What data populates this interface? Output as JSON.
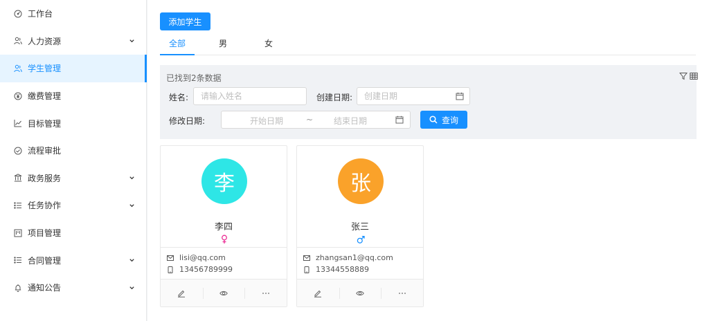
{
  "sidebar": {
    "items": [
      {
        "label": "工作台",
        "icon": "dashboard-icon",
        "has_children": false
      },
      {
        "label": "人力资源",
        "icon": "team-icon",
        "has_children": true
      },
      {
        "label": "学生管理",
        "icon": "team-icon",
        "has_children": false,
        "active": true
      },
      {
        "label": "缴费管理",
        "icon": "yen-icon",
        "has_children": false
      },
      {
        "label": "目标管理",
        "icon": "line-chart-icon",
        "has_children": false
      },
      {
        "label": "流程审批",
        "icon": "check-circle-icon",
        "has_children": false
      },
      {
        "label": "政务服务",
        "icon": "bank-icon",
        "has_children": true
      },
      {
        "label": "任务协作",
        "icon": "list-icon",
        "has_children": true
      },
      {
        "label": "项目管理",
        "icon": "project-icon",
        "has_children": false
      },
      {
        "label": "合同管理",
        "icon": "list-icon",
        "has_children": true
      },
      {
        "label": "通知公告",
        "icon": "bell-icon",
        "has_children": true
      }
    ]
  },
  "toolbar": {
    "add_label": "添加学生"
  },
  "tabs": [
    {
      "label": "全部",
      "active": true
    },
    {
      "label": "男",
      "active": false
    },
    {
      "label": "女",
      "active": false
    }
  ],
  "filter": {
    "found_text": "已找到2条数据",
    "name_label": "姓名:",
    "name_placeholder": "请输入姓名",
    "created_label": "创建日期:",
    "created_placeholder": "创建日期",
    "modified_label": "修改日期:",
    "start_placeholder": "开始日期",
    "range_sep": "~",
    "end_placeholder": "结束日期",
    "search_label": "查询"
  },
  "students": [
    {
      "avatar_char": "李",
      "avatar_color": "#2ee6e6",
      "name": "李四",
      "gender": "female",
      "gender_color": "#eb2f96",
      "email": "lisi@qq.com",
      "phone": "13456789999"
    },
    {
      "avatar_char": "张",
      "avatar_color": "#faa22a",
      "name": "张三",
      "gender": "male",
      "gender_color": "#1890ff",
      "email": "zhangsan1@qq.com",
      "phone": "13344558889"
    }
  ],
  "colors": {
    "primary": "#1890ff"
  }
}
